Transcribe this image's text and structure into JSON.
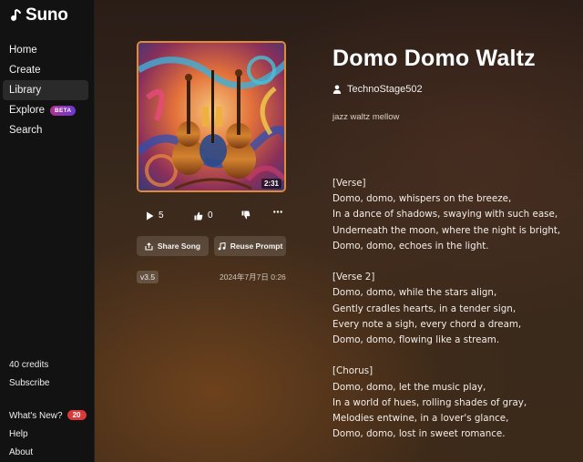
{
  "app": {
    "name": "Suno"
  },
  "sidebar": {
    "items": [
      {
        "label": "Home"
      },
      {
        "label": "Create"
      },
      {
        "label": "Library"
      },
      {
        "label": "Explore",
        "badge": "BETA"
      },
      {
        "label": "Search"
      }
    ],
    "active": "Library",
    "credits": "40 credits",
    "subscribe": "Subscribe",
    "whats_new": "What's New?",
    "whats_new_count": "20",
    "help": "Help",
    "about": "About"
  },
  "song": {
    "title": "Domo Domo Waltz",
    "artist": "TechnoStage502",
    "tags": "jazz waltz mellow",
    "duration": "2:31",
    "plays": "5",
    "likes": "0",
    "version": "v3.5",
    "date": "2024年7月7日 0:26",
    "share_label": "Share Song",
    "reuse_label": "Reuse Prompt",
    "lyrics": "[Verse]\nDomo, domo, whispers on the breeze,\nIn a dance of shadows, swaying with such ease,\nUnderneath the moon, where the night is bright,\nDomo, domo, echoes in the light.\n\n[Verse 2]\nDomo, domo, while the stars align,\nGently cradles hearts, in a tender sign,\nEvery note a sigh, every chord a dream,\nDomo, domo, flowing like a stream.\n\n[Chorus]\nDomo, domo, let the music play,\nIn a world of hues, rolling shades of gray,\nMelodies entwine, in a lover's glance,\nDomo, domo, lost in sweet romance."
  },
  "colors": {
    "accent_border": "#e08a3c",
    "badge_red": "#d83a3a",
    "beta_gradient": [
      "#b0338f",
      "#6a38d6"
    ]
  },
  "icons": {
    "play": "play-icon",
    "like": "thumbs-up-icon",
    "dislike": "thumbs-down-icon",
    "more": "more-icon",
    "share": "share-icon",
    "reuse": "music-note-icon",
    "user": "user-icon"
  }
}
